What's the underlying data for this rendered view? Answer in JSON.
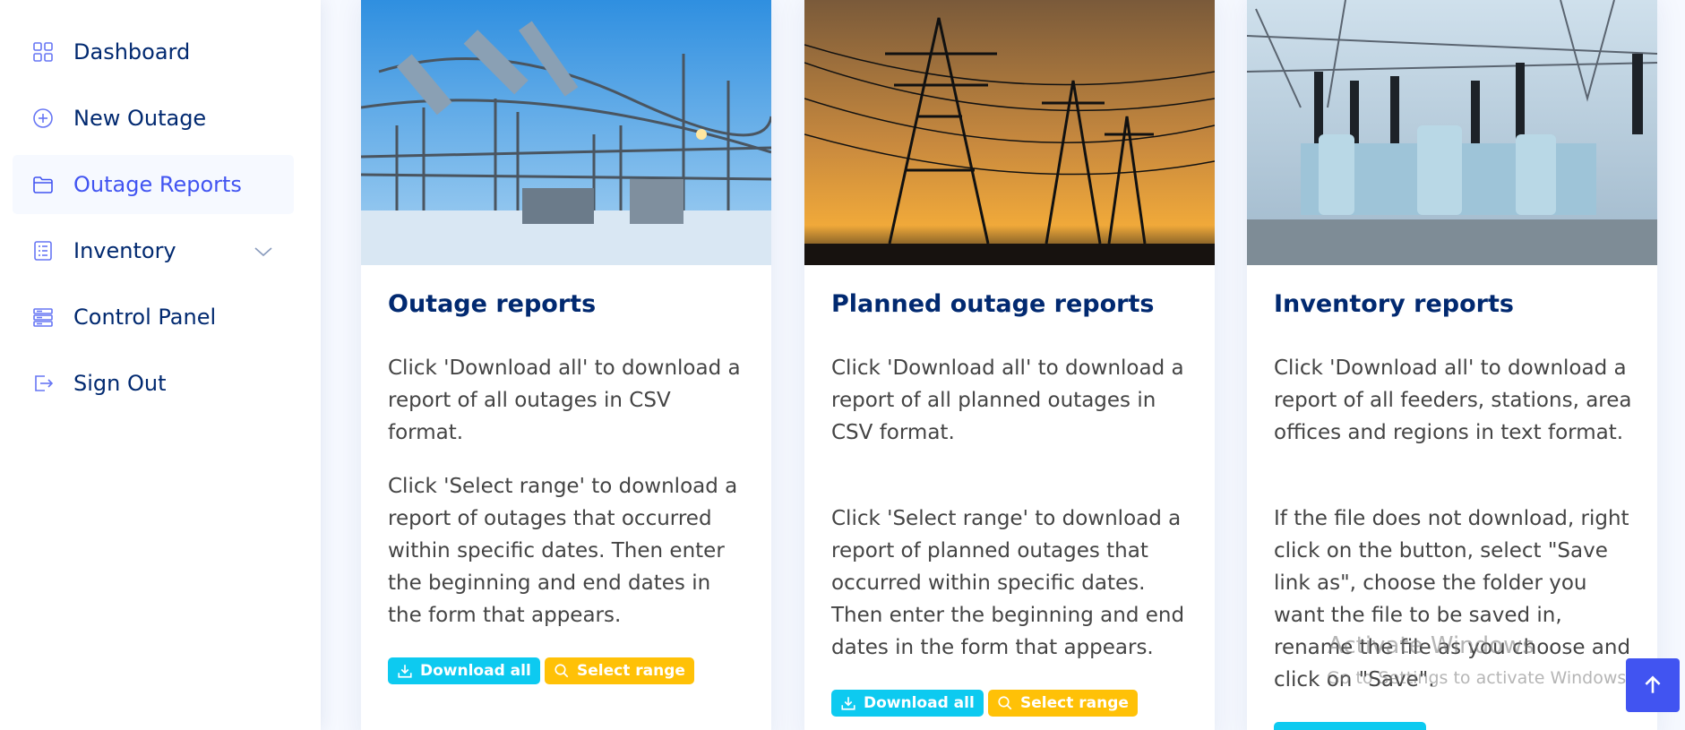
{
  "sidebar": {
    "items": [
      {
        "label": "Dashboard",
        "icon": "grid-icon"
      },
      {
        "label": "New Outage",
        "icon": "plus-circle-icon"
      },
      {
        "label": "Outage Reports",
        "icon": "folder-icon",
        "active": true
      },
      {
        "label": "Inventory",
        "icon": "list-icon",
        "has_chevron": true
      },
      {
        "label": "Control Panel",
        "icon": "server-icon"
      },
      {
        "label": "Sign Out",
        "icon": "sign-out-icon"
      }
    ]
  },
  "cards": [
    {
      "title": "Outage reports",
      "p1": "Click 'Download all' to download a report of all outages in CSV format.",
      "p2": "Click 'Select range' to download a report of outages that occurred within specific dates. Then enter the beginning and end dates in the form that appears.",
      "download_label": "Download all",
      "range_label": "Select range"
    },
    {
      "title": "Planned outage reports",
      "p1": "Click 'Download all' to download a report of all planned outages in CSV format.",
      "p2": "Click 'Select range' to download a report of planned outages that occurred within specific dates. Then enter the beginning and end dates in the form that appears.",
      "download_label": "Download all",
      "range_label": "Select range"
    },
    {
      "title": "Inventory reports",
      "p1": "Click 'Download all' to download a report of all feeders, stations, area offices and regions in text format.",
      "p2": "If the file does not download, right click on the button, select \"Save link as\", choose the folder you want the file to be saved in, rename the file as you choose and click on \"Save\"."
    }
  ],
  "watermark": {
    "line1": "Activate Windows",
    "line2": "Go to Settings to activate Windows."
  },
  "colors": {
    "primary": "#4154f1",
    "navy": "#012970",
    "info": "#0dcaf0",
    "warning": "#ffc107"
  }
}
